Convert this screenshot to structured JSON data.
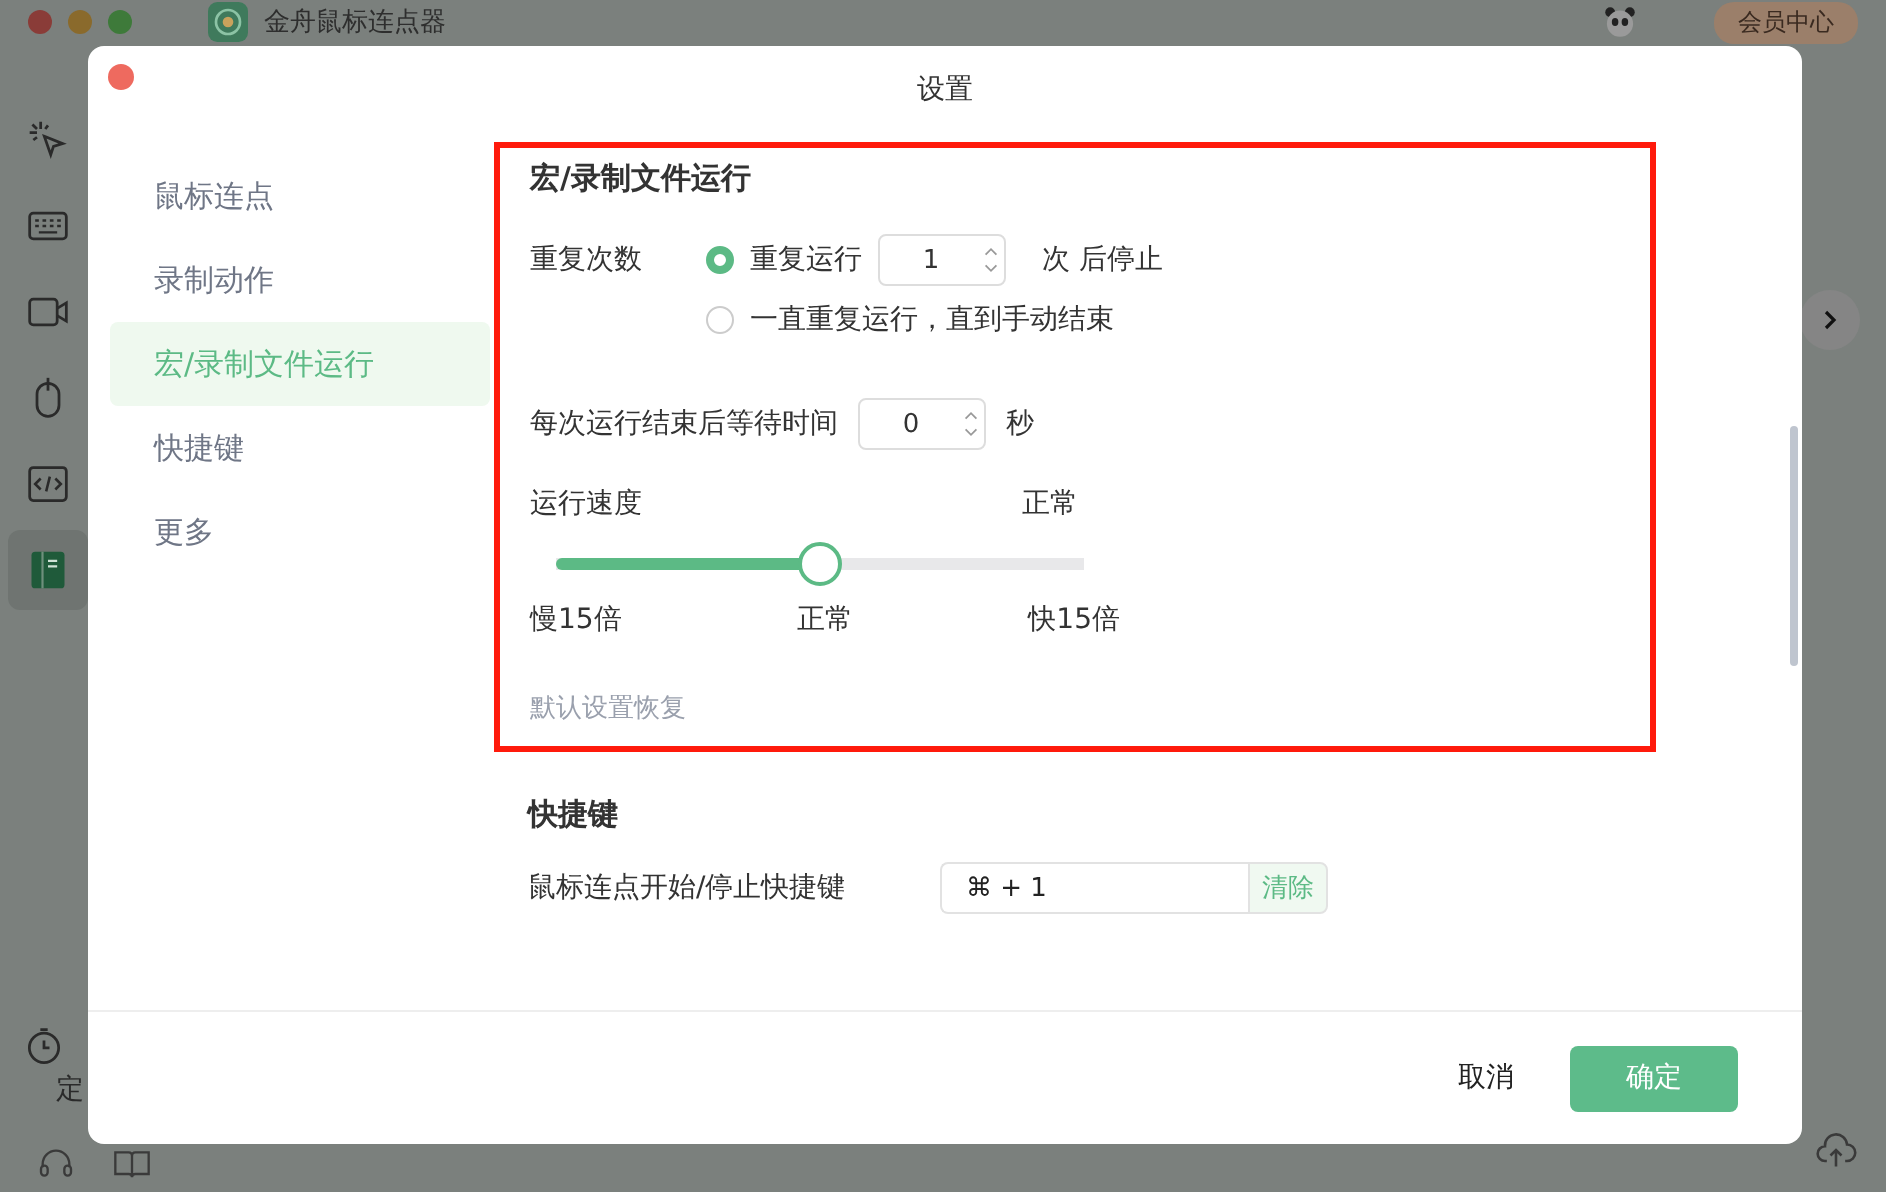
{
  "app": {
    "title": "金舟鼠标连点器",
    "member_button": "会员中心",
    "timer_label": "定",
    "sidebar": [
      {
        "kind": "cursor",
        "selected": false
      },
      {
        "kind": "keyboard",
        "selected": false
      },
      {
        "kind": "camera",
        "selected": false
      },
      {
        "kind": "mouse",
        "selected": false
      },
      {
        "kind": "code",
        "selected": false
      },
      {
        "kind": "notebook",
        "selected": true
      }
    ]
  },
  "dialog": {
    "title": "设置",
    "nav": [
      {
        "label": "鼠标连点",
        "selected": false
      },
      {
        "label": "录制动作",
        "selected": false
      },
      {
        "label": "宏/录制文件运行",
        "selected": true
      },
      {
        "label": "快捷键",
        "selected": false
      },
      {
        "label": "更多",
        "selected": false
      }
    ],
    "macro": {
      "title": "宏/录制文件运行",
      "repeat_label": "重复次数",
      "options": [
        {
          "kind": "count",
          "label": "重复运行",
          "selected": true,
          "value": "1",
          "suffix": "次 后停止"
        },
        {
          "kind": "plain",
          "label": "一直重复运行，直到手动结束",
          "selected": false
        }
      ],
      "wait_label": "每次运行结束后等待时间",
      "wait_value": "0",
      "wait_unit": "秒",
      "speed_label": "运行速度",
      "speed_current": "正常",
      "level": 0.5,
      "speed_ticks": [
        "慢15倍",
        "正常",
        "快15倍"
      ],
      "reset_link": "默认设置恢复"
    },
    "shortcuts": {
      "title": "快捷键",
      "rows": [
        {
          "label": "鼠标连点开始/停止快捷键",
          "value": "⌘ + 1",
          "clear": "清除"
        }
      ]
    },
    "footer": {
      "cancel": "取消",
      "ok": "确定"
    }
  }
}
